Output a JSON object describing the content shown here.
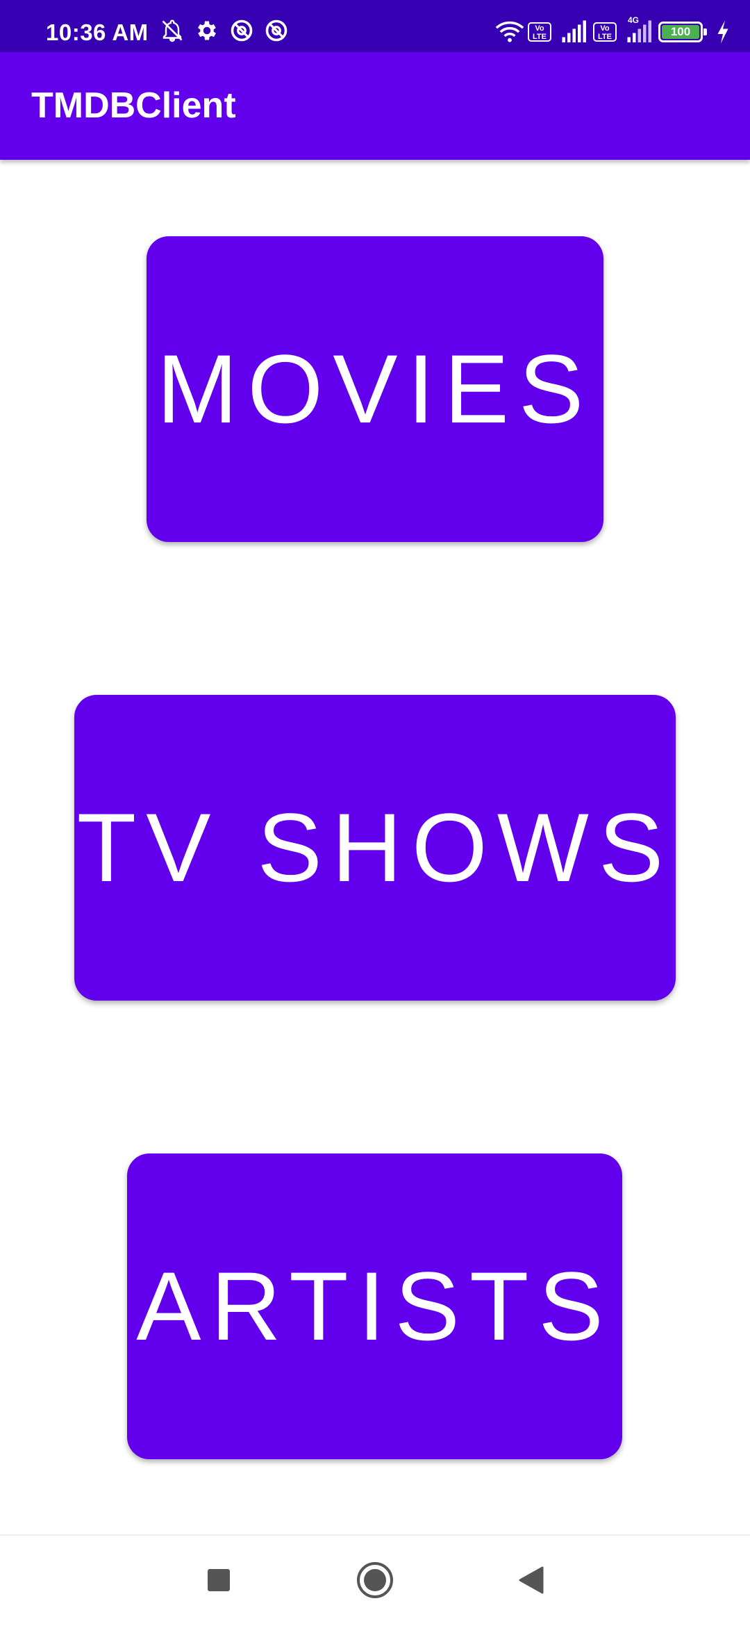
{
  "status_bar": {
    "time": "10:36 AM",
    "battery_level": "100",
    "volte_label_1": "Vo LTE",
    "volte_label_2": "Vo LTE",
    "network_type": "4G",
    "icons": [
      "notifications-off-icon",
      "settings-icon",
      "vpn-icon",
      "vpn-icon",
      "wifi-icon",
      "volte-icon",
      "signal-icon",
      "volte-icon",
      "signal-4g-icon",
      "battery-icon",
      "charging-icon"
    ],
    "background_color": "#3700B3"
  },
  "app_bar": {
    "title": "TMDBClient",
    "background_color": "#6200EE"
  },
  "menu": {
    "movies_label": "MOVIES",
    "tv_shows_label": "TV SHOWS",
    "artists_label": "ARTISTS",
    "button_color": "#6200EE"
  },
  "nav_bar": {
    "icons": [
      "recents-square-icon",
      "home-circle-icon",
      "back-triangle-icon"
    ]
  }
}
